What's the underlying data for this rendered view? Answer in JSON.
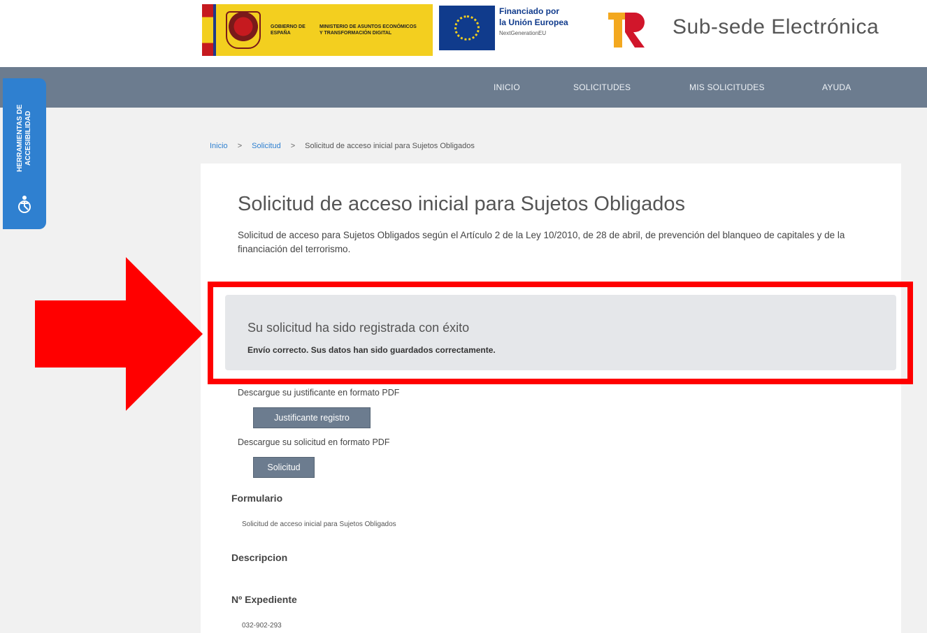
{
  "header": {
    "gov_logo_text_1": "GOBIERNO DE ESPAÑA",
    "gov_logo_text_2": "MINISTERIO DE ASUNTOS ECONÓMICOS Y TRANSFORMACIÓN DIGITAL",
    "eu_text_line1": "Financiado por",
    "eu_text_line2": "la Unión Europea",
    "eu_text_line3": "NextGenerationEU",
    "site_title": "Sub-sede Electrónica"
  },
  "nav": {
    "items": [
      {
        "label": "INICIO"
      },
      {
        "label": "SOLICITUDES"
      },
      {
        "label": "MIS SOLICITUDES"
      },
      {
        "label": "AYUDA"
      }
    ]
  },
  "accessibility": {
    "label": "HERRAMIENTAS DE ACCESIBILIDAD",
    "icon": "accessibility-icon",
    "color": "#2f80d0"
  },
  "breadcrumb": {
    "items": [
      {
        "label": "Inicio"
      },
      {
        "label": "Solicitud"
      },
      {
        "label": "Solicitud de acceso inicial para Sujetos Obligados"
      }
    ],
    "separator": ">"
  },
  "page": {
    "title": "Solicitud de acceso inicial para Sujetos Obligados",
    "description": "Solicitud de acceso para Sujetos Obligados según el Artículo 2 de la Ley 10/2010, de 28 de abril, de prevención del blanqueo de capitales y de la financiación del terrorismo."
  },
  "alert": {
    "title": "Su solicitud ha sido registrada con éxito",
    "message": "Envío correcto. Sus datos han sido guardados correctamente.",
    "highlight_color": "#ff0000"
  },
  "downloads": {
    "justificante_text": "Descargue su justificante en formato PDF",
    "justificante_button": "Justificante registro",
    "solicitud_text": "Descargue su solicitud en formato PDF",
    "solicitud_button": "Solicitud"
  },
  "details": {
    "formulario_label": "Formulario",
    "formulario_value": "Solicitud de acceso inicial para Sujetos Obligados",
    "descripcion_label": "Descripcion",
    "expediente_label": "Nº Expediente",
    "expediente_value": "032-902-293"
  },
  "colors": {
    "nav_bg": "#6c7c8f",
    "accent_blue": "#2f80d0",
    "alert_bg": "#e5e7ea"
  }
}
